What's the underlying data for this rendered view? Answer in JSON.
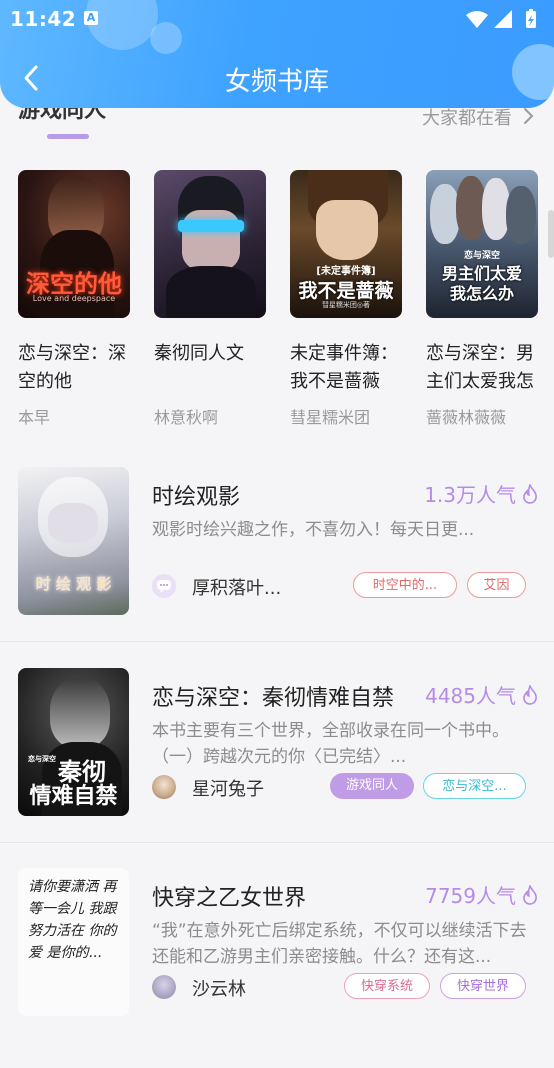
{
  "status": {
    "time": "11:42",
    "notif_badge": "A"
  },
  "header": {
    "title": "女频书库",
    "accent": "#3ea2ff"
  },
  "section": {
    "title": "游戏同人",
    "more": "大家都在看"
  },
  "carousel": [
    {
      "title": "恋与深空：深空的他",
      "author": "本早",
      "cover_text": "深空的他",
      "cover_sub": "Love and deepspace"
    },
    {
      "title": "秦彻同人文",
      "author": "林意秋啊"
    },
    {
      "title": "未定事件簿：我不是蔷薇",
      "author": "彗星糯米团",
      "cover_text": "我不是蔷薇",
      "cover_top": "[未定事件簿]",
      "cover_sub": "彗星糯米团◎著"
    },
    {
      "title": "恋与深空：男主们太爱我怎么办",
      "author": "蔷薇林薇薇",
      "cover_text": "男主们太爱",
      "cover_text2": "我怎么办",
      "cover_top": "恋与深空"
    }
  ],
  "list": [
    {
      "title": "时绘观影",
      "popularity": "1.3万人气",
      "desc": "观影时绘兴趣之作，不喜勿入！每天日更...",
      "author": "厚积落叶...",
      "tags": [
        "时空中的...",
        "艾因"
      ],
      "cover_text": "时 绘 观 影"
    },
    {
      "title": "恋与深空：秦彻情难自禁",
      "popularity": "4485人气",
      "desc": "本书主要有三个世界，全部收录在同一个书中。（一）跨越次元的你〈已完结〉...",
      "author": "星河兔子",
      "tags": [
        "游戏同人",
        "恋与深空..."
      ],
      "cover_text": "秦彻",
      "cover_text2": "情难自禁",
      "cover_small": "恋与深空"
    },
    {
      "title": "快穿之乙女世界",
      "popularity": "7759人气",
      "desc": "“我”在意外死亡后绑定系统，不仅可以继续活下去还能和乙游男主们亲密接触。什么？还有这...",
      "author": "沙云林",
      "tags": [
        "快穿系统",
        "快穿世界"
      ],
      "cover_text": "请你要潇洒 再等一会儿 我跟努力活在 你的爱 是你的..."
    }
  ]
}
